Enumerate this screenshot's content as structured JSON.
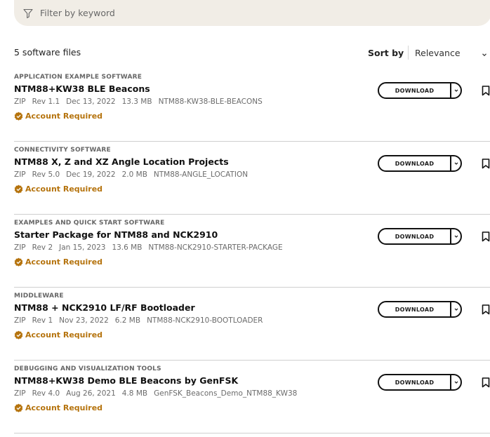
{
  "filter": {
    "placeholder": "Filter by keyword",
    "icon": "funnel-icon"
  },
  "results": {
    "count_label": "5 software files"
  },
  "sort": {
    "label": "Sort by",
    "value": "Relevance"
  },
  "accent_color": "#b5730d",
  "download_label": "DOWNLOAD",
  "files": [
    {
      "category": "APPLICATION EXAMPLE SOFTWARE",
      "title": "NTM88+KW38 BLE Beacons",
      "type": "ZIP",
      "rev": "Rev 1.1",
      "date": "Dec 13, 2022",
      "size": "13.3 MB",
      "id": "NTM88-KW38-BLE-BEACONS",
      "access": "Account Required"
    },
    {
      "category": "CONNECTIVITY SOFTWARE",
      "title": "NTM88 X, Z and XZ Angle Location Projects",
      "type": "ZIP",
      "rev": "Rev 5.0",
      "date": "Dec 19, 2022",
      "size": "2.0 MB",
      "id": "NTM88-ANGLE_LOCATION",
      "access": "Account Required"
    },
    {
      "category": "EXAMPLES AND QUICK START SOFTWARE",
      "title": "Starter Package for NTM88 and NCK2910",
      "type": "ZIP",
      "rev": "Rev 2",
      "date": "Jan 15, 2023",
      "size": "13.6 MB",
      "id": "NTM88-NCK2910-STARTER-PACKAGE",
      "access": "Account Required"
    },
    {
      "category": "MIDDLEWARE",
      "title": "NTM88 + NCK2910 LF/RF Bootloader",
      "type": "ZIP",
      "rev": "Rev 1",
      "date": "Nov 23, 2022",
      "size": "6.2 MB",
      "id": "NTM88-NCK2910-BOOTLOADER",
      "access": "Account Required"
    },
    {
      "category": "DEBUGGING AND VISUALIZATION TOOLS",
      "title": "NTM88+KW38 Demo BLE Beacons by GenFSK",
      "type": "ZIP",
      "rev": "Rev 4.0",
      "date": "Aug 26, 2021",
      "size": "4.8 MB",
      "id": "GenFSK_Beacons_Demo_NTM88_KW38",
      "access": "Account Required"
    }
  ]
}
